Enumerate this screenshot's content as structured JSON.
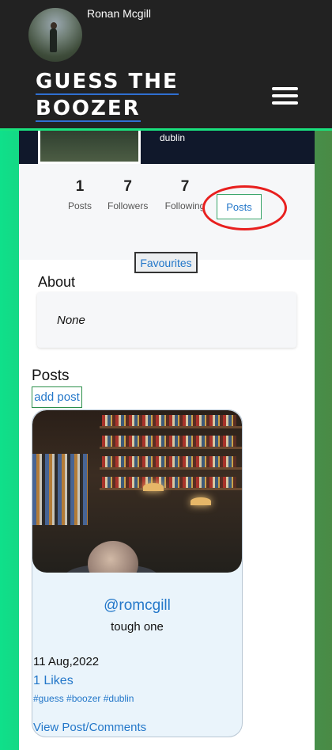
{
  "header": {
    "username": "Ronan Mcgill",
    "brand_line1": "GUESS THE",
    "brand_line2": "BOOZER"
  },
  "profile": {
    "location": "dublin",
    "stats": [
      {
        "value": "1",
        "label": "Posts"
      },
      {
        "value": "7",
        "label": "Followers"
      },
      {
        "value": "7",
        "label": "Following"
      }
    ],
    "posts_button": "Posts",
    "favourites_button": "Favourites",
    "about_title": "About",
    "about_text": "None"
  },
  "posts_section": {
    "title": "Posts",
    "add_post": "add post",
    "post": {
      "handle": "@romcgill",
      "caption": "tough one",
      "date": "11 Aug,2022",
      "likes": "1 Likes",
      "tags": "#guess #boozer #dublin",
      "view_link": "View Post/Comments"
    }
  },
  "colors": {
    "header_bg": "#222222",
    "accent_green": "#19e27e",
    "link_blue": "#2377c9",
    "highlight_red": "#e8201f"
  }
}
